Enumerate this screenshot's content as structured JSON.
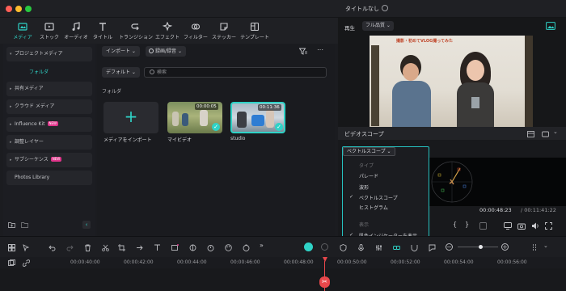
{
  "window": {
    "title": "タイトルなし"
  },
  "toolbar": {
    "items": [
      {
        "label": "メディア",
        "icon": "media-icon",
        "active": true
      },
      {
        "label": "ストック",
        "icon": "stock-icon"
      },
      {
        "label": "オーディオ",
        "icon": "music-icon"
      },
      {
        "label": "タイトル",
        "icon": "title-icon"
      },
      {
        "label": "トランジション",
        "icon": "transition-icon"
      },
      {
        "label": "エフェクト",
        "icon": "effect-icon"
      },
      {
        "label": "フィルター",
        "icon": "filter-icon"
      },
      {
        "label": "ステッカー",
        "icon": "sticker-icon"
      },
      {
        "label": "テンプレート",
        "icon": "template-icon"
      }
    ]
  },
  "sidebar": {
    "items": [
      {
        "label": "プロジェクトメディア",
        "expanded": true
      },
      {
        "label": "フォルダ",
        "selected": true
      },
      {
        "label": "共有メディア"
      },
      {
        "label": "クラウド メディア"
      },
      {
        "label": "Influence Kit",
        "badge": "NEW"
      },
      {
        "label": "調整レイヤー"
      },
      {
        "label": "サブシーケンス",
        "badge": "NEW"
      },
      {
        "label": "Photos Library"
      }
    ]
  },
  "media": {
    "import_button": "インポート",
    "record_button": "録画/録音",
    "sort_button": "デフォルト",
    "search_placeholder": "検索",
    "section_label": "フォルダ",
    "items": [
      {
        "label": "メディアをインポート"
      },
      {
        "label": "マイビデオ",
        "duration": "00:00:05"
      },
      {
        "label": "studio",
        "duration": "00:11:36"
      }
    ]
  },
  "preview": {
    "play_label": "再生",
    "quality_label": "フル品質",
    "video_caption": "撮影・初めてVLOG撮ってみた"
  },
  "scope": {
    "title": "ビデオスコープ",
    "dropdown_label": "ベクトルスコープ",
    "current_time": "00:00:48:23",
    "total_time": "/ 00:11:41:22"
  },
  "popup": {
    "type_header": "タイプ",
    "types": [
      {
        "label": "パレード",
        "checked": false
      },
      {
        "label": "波形",
        "checked": false
      },
      {
        "label": "ベクトルスコープ",
        "checked": true
      },
      {
        "label": "ヒストグラム",
        "checked": false
      }
    ],
    "display_header": "表示",
    "display_option": {
      "label": "肌色インジケーターを表示",
      "checked": true
    }
  },
  "timeline": {
    "ticks": [
      "00:00:40:00",
      "00:00:42:00",
      "00:00:44:00",
      "00:00:46:00",
      "00:00:48:00",
      "00:00:50:00",
      "00:00:52:00",
      "00:00:54:00",
      "00:00:56:00"
    ]
  },
  "colors": {
    "accent": "#2fd3c7",
    "playhead": "#e8474b",
    "new_badge": "#e0358b"
  }
}
